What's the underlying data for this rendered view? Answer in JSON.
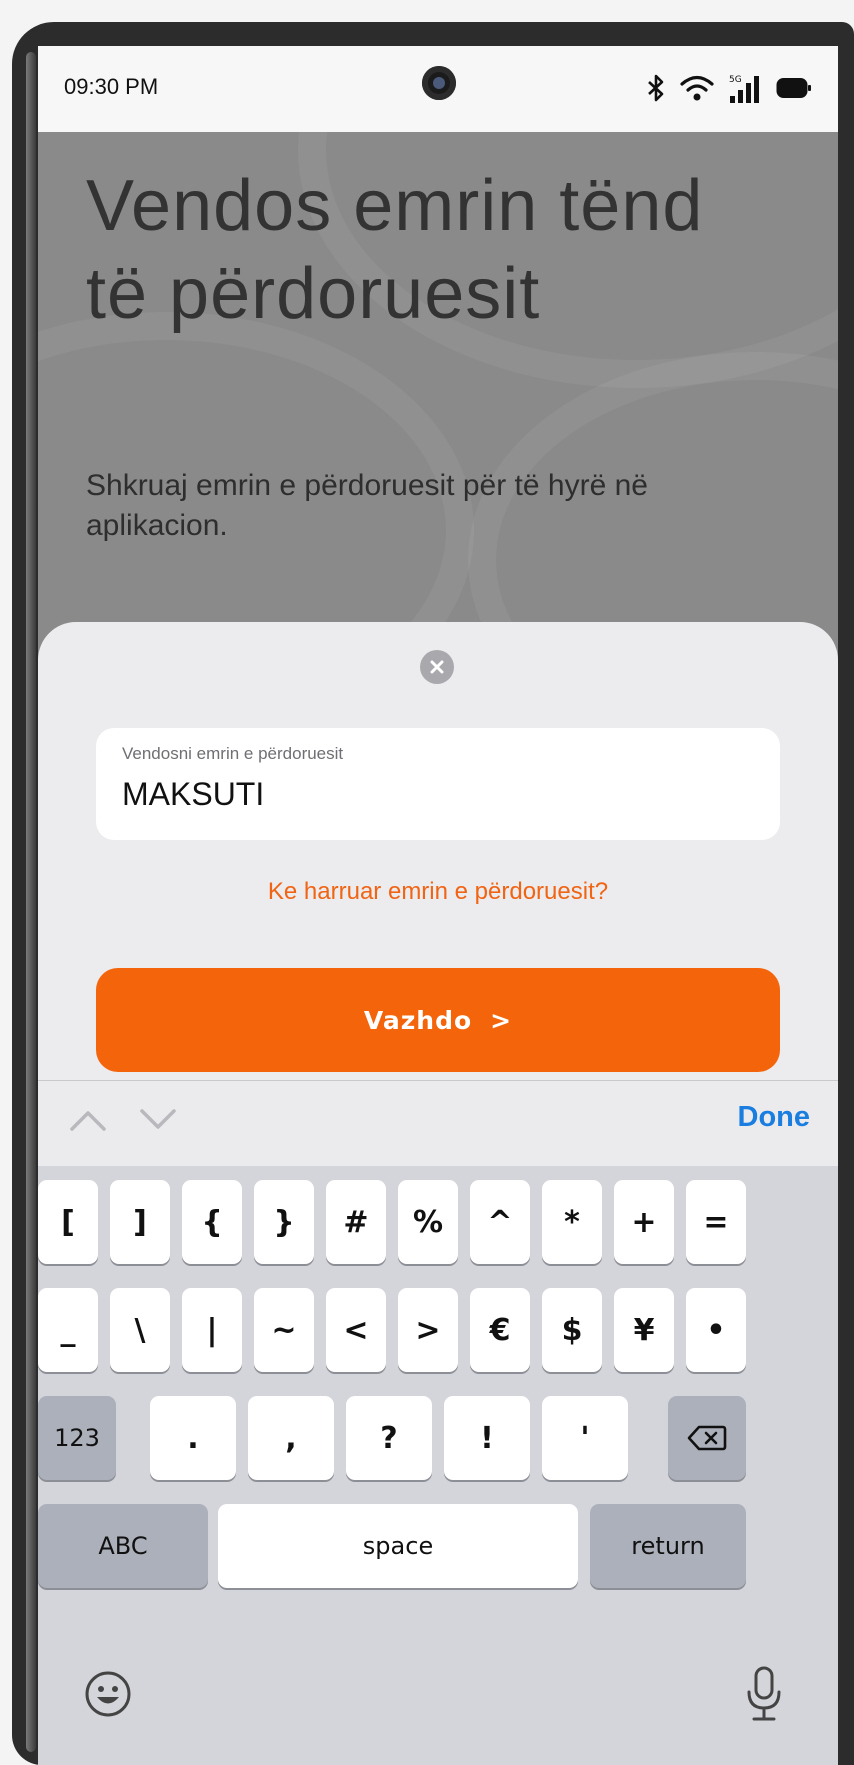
{
  "status_bar": {
    "time": "09:30 PM",
    "icons": [
      "bluetooth-icon",
      "wifi-icon",
      "5g-signal-icon",
      "battery-icon"
    ],
    "network_label": "5G"
  },
  "header": {
    "title": "Vendos emrin tënd të përdoruesit",
    "subtitle": "Shkruaj emrin e përdoruesit për të hyrë në aplikacion."
  },
  "sheet": {
    "close_icon": "close-icon",
    "username_field": {
      "label": "Vendosni emrin e përdoruesit",
      "value": "MAKSUTI"
    },
    "forgot_link": "Ke harruar emrin e përdoruesit?",
    "continue_button": {
      "label": "Vazhdo",
      "chevron": ">"
    }
  },
  "keyboard_toolbar": {
    "prev_icon": "chevron-up-icon",
    "next_icon": "chevron-down-icon",
    "done_label": "Done"
  },
  "keyboard": {
    "row1": [
      "[",
      "]",
      "{",
      "}",
      "#",
      "%",
      "^",
      "*",
      "+",
      "="
    ],
    "row2": [
      "_",
      "\\",
      "|",
      "~",
      "<",
      ">",
      "€",
      "$",
      "¥",
      "•"
    ],
    "row3": {
      "mode_key": "123",
      "keys": [
        ".",
        ",",
        "?",
        "!",
        "'"
      ],
      "delete_icon": "backspace-icon"
    },
    "row4": {
      "abc": "ABC",
      "space": "space",
      "return": "return"
    },
    "emoji_icon": "emoji-icon",
    "mic_icon": "microphone-icon"
  },
  "colors": {
    "accent": "#f4650b",
    "link": "#f06414",
    "done": "#1a7de0",
    "header_bg": "#8a8a8a"
  }
}
